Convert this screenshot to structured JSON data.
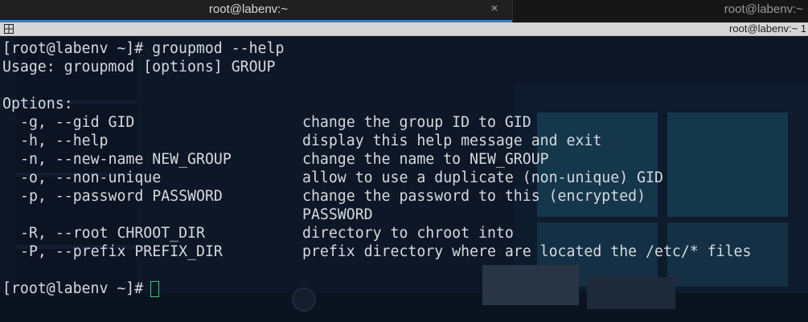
{
  "tabs": {
    "active": {
      "title": "root@labenv:~",
      "close_symbol": "×"
    },
    "inactive": {
      "title": "root@labenv:~"
    }
  },
  "title_strip": {
    "title": "root@labenv:~ 1"
  },
  "terminal": {
    "command_prompt": "[root@labenv ~]# ",
    "command": "groupmod --help",
    "usage": "Usage: groupmod [options] GROUP",
    "options_heading": "Options:",
    "options": [
      {
        "flag": "-g, --gid GID",
        "description": "change the group ID to GID"
      },
      {
        "flag": "-h, --help",
        "description": "display this help message and exit"
      },
      {
        "flag": "-n, --new-name NEW_GROUP",
        "description": "change the name to NEW_GROUP"
      },
      {
        "flag": "-o, --non-unique",
        "description": "allow to use a duplicate (non-unique) GID"
      },
      {
        "flag": "-p, --password PASSWORD",
        "description": "change the password to this (encrypted)",
        "description_cont": "PASSWORD"
      },
      {
        "flag": "-R, --root CHROOT_DIR",
        "description": "directory to chroot into"
      },
      {
        "flag": "-P, --prefix PREFIX_DIR",
        "description": "prefix directory where are located the /etc/* files"
      }
    ],
    "final_prompt": "[root@labenv ~]#"
  },
  "colors": {
    "text": "#d5dae0",
    "tab_accent": "#3e7bd8",
    "cursor": "#2fd16c",
    "background": "#0f1828"
  },
  "icons": {
    "strip_icon": "split-grid-icon",
    "cursor": "block-cursor"
  }
}
